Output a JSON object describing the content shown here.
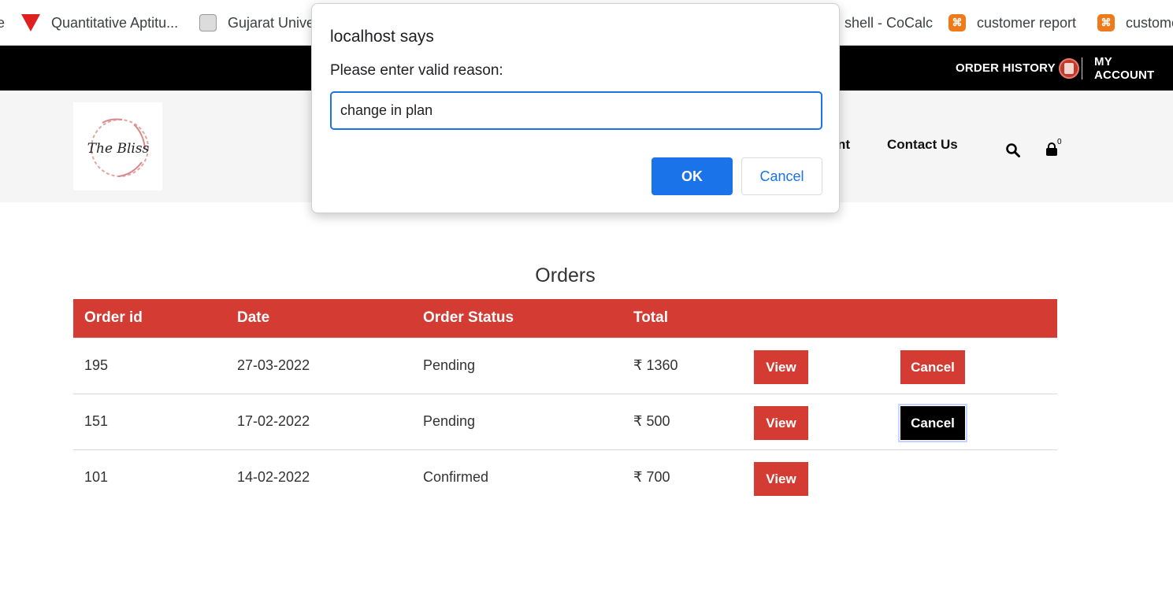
{
  "bookmarks": [
    {
      "label": "e",
      "icon": "bookmark-partial"
    },
    {
      "label": "Quantitative Aptitu...",
      "icon": "red-t-icon"
    },
    {
      "label": "Gujarat Unive",
      "icon": "university-seal-icon"
    },
    {
      "label": "shell - CoCalc",
      "icon": ""
    },
    {
      "label": "customer report",
      "icon": "xampp-icon"
    },
    {
      "label": "custome",
      "icon": "xampp-icon"
    }
  ],
  "topbar": {
    "order_history": "ORDER HISTORY",
    "my_account": "MY ACCOUNT"
  },
  "nav": {
    "partial": "nt",
    "contact": "Contact Us",
    "cart_count": "0"
  },
  "logo": {
    "text": "The Bliss"
  },
  "orders": {
    "title": "Orders",
    "headers": [
      "Order id",
      "Date",
      "Order Status",
      "Total"
    ],
    "rows": [
      {
        "id": "195",
        "date": "27-03-2022",
        "status": "Pending",
        "total": "₹ 1360",
        "view": "View",
        "cancel": "Cancel"
      },
      {
        "id": "151",
        "date": "17-02-2022",
        "status": "Pending",
        "total": "₹ 500",
        "view": "View",
        "cancel": "Cancel"
      },
      {
        "id": "101",
        "date": "14-02-2022",
        "status": "Confirmed",
        "total": "₹ 700",
        "view": "View"
      }
    ]
  },
  "dialog": {
    "title": "localhost says",
    "message": "Please enter valid reason:",
    "input_value": "change in plan",
    "ok": "OK",
    "cancel": "Cancel"
  },
  "colors": {
    "accent_red": "#d43c33",
    "dialog_blue": "#1a73e8",
    "topbar": "#000000"
  }
}
